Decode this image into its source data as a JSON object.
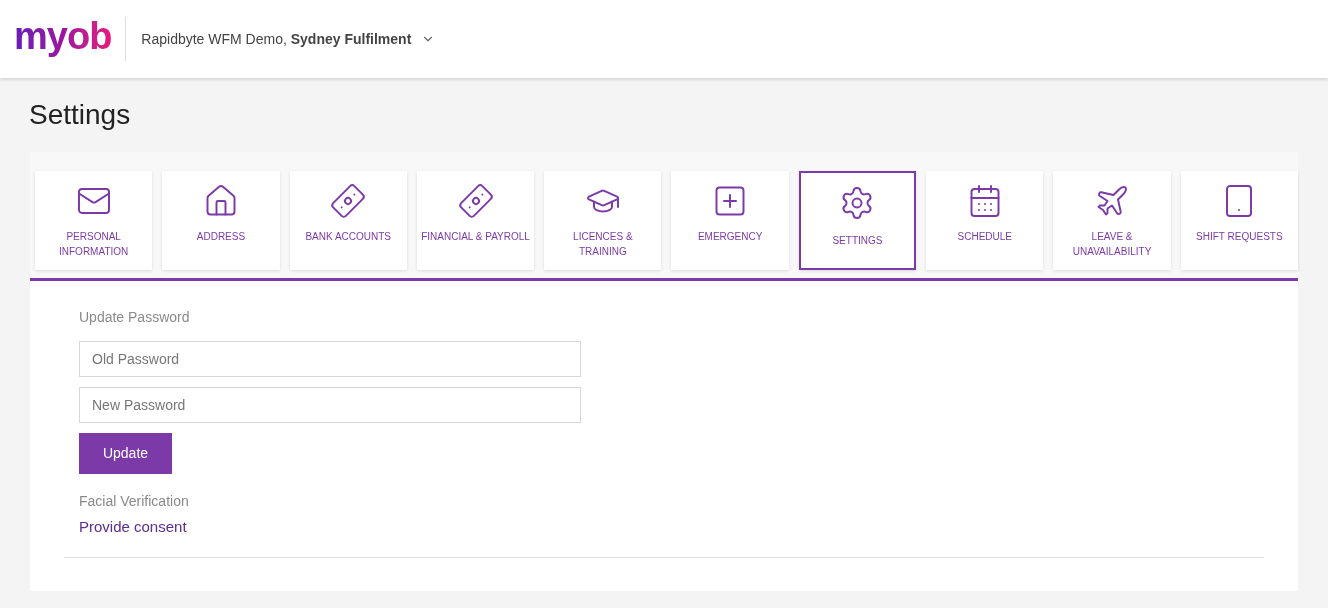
{
  "header": {
    "logo": "myob",
    "business": "Rapidbyte WFM Demo,",
    "location": "Sydney Fulfilment"
  },
  "page_title": "Settings",
  "tabs": [
    {
      "kind": "mail",
      "label": "PERSONAL INFORMATION",
      "selected": false
    },
    {
      "kind": "house",
      "label": "ADDRESS",
      "selected": false
    },
    {
      "kind": "money",
      "label": "BANK ACCOUNTS",
      "selected": false
    },
    {
      "kind": "money",
      "label": "FINANCIAL & PAYROLL",
      "selected": false
    },
    {
      "kind": "cap",
      "label": "LICENCES & TRAINING",
      "selected": false
    },
    {
      "kind": "cross",
      "label": "EMERGENCY",
      "selected": false
    },
    {
      "kind": "gear",
      "label": "SETTINGS",
      "selected": true
    },
    {
      "kind": "calendar",
      "label": "SCHEDULE",
      "selected": false
    },
    {
      "kind": "plane",
      "label": "LEAVE & UNAVAILABILITY",
      "selected": false
    },
    {
      "kind": "tablet",
      "label": "SHIFT REQUESTS",
      "selected": false
    }
  ],
  "password": {
    "heading": "Update Password",
    "old": {
      "placeholder": "Old Password"
    },
    "new": {
      "placeholder": "New Password"
    },
    "button": "Update"
  },
  "facial": {
    "heading": "Facial Verification",
    "link": "Provide consent"
  }
}
